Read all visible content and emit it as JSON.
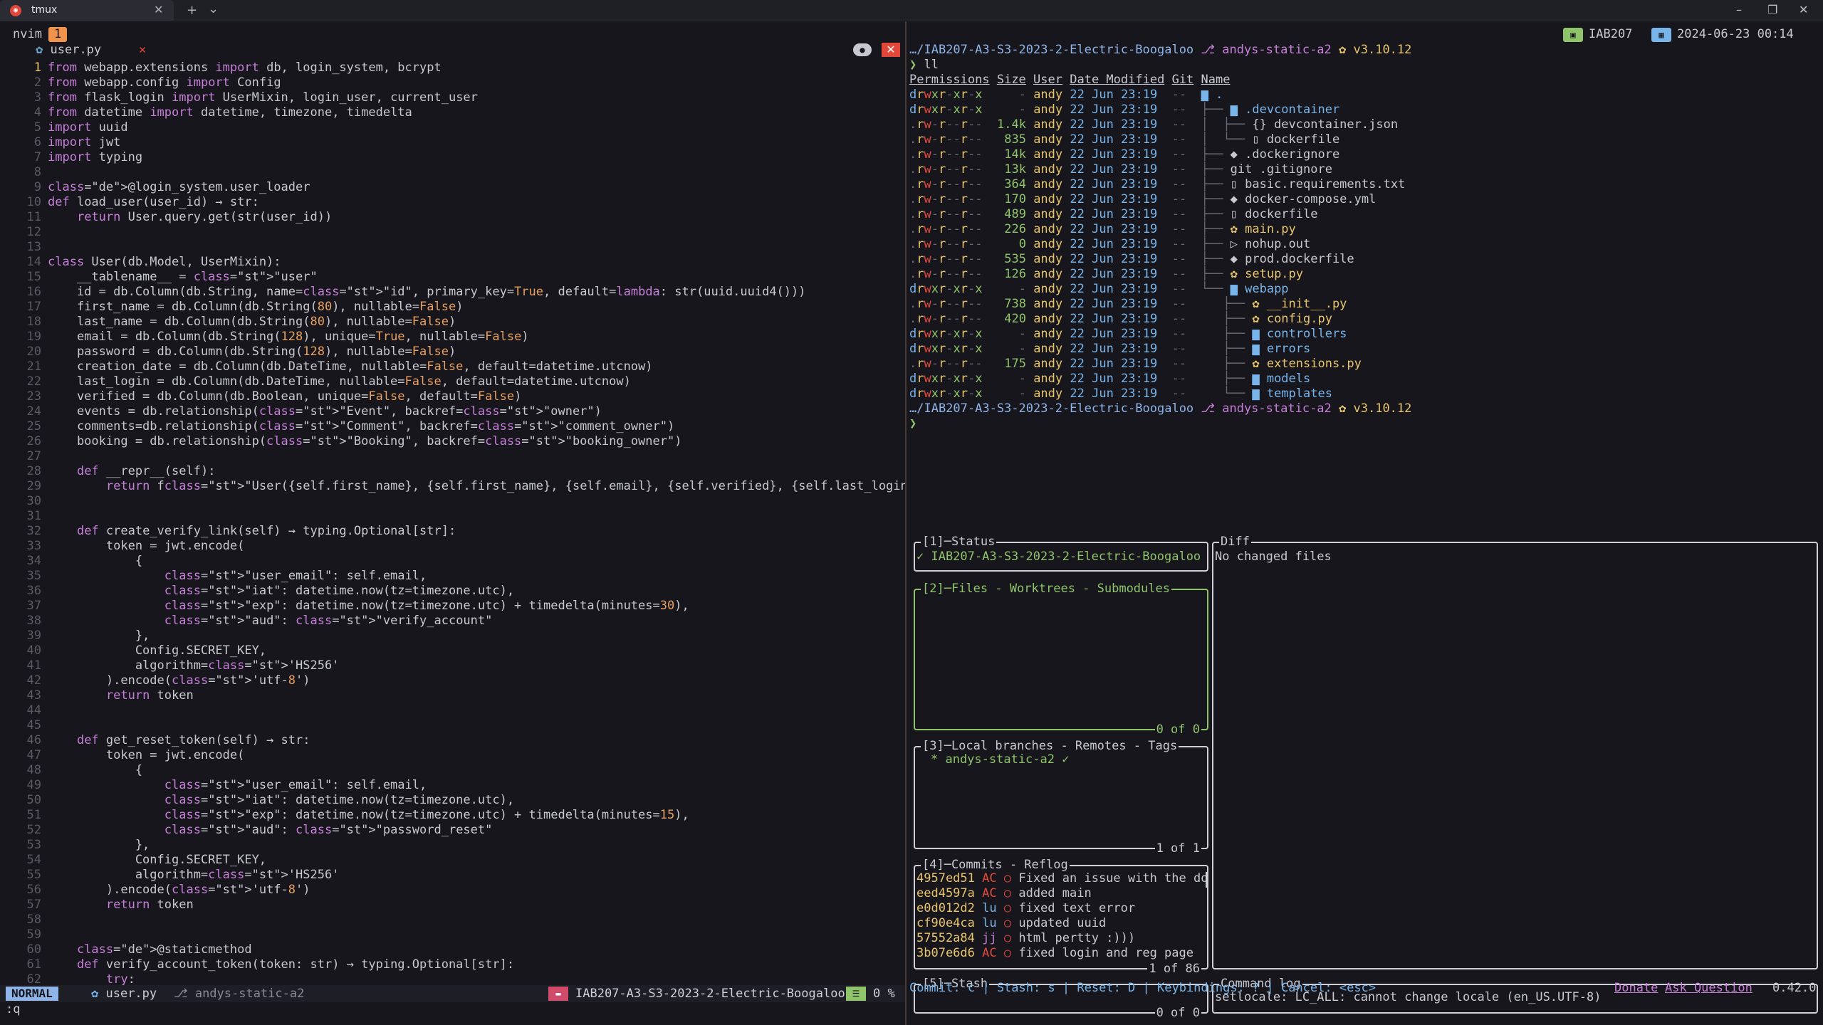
{
  "window": {
    "tab_title": "tmux",
    "new_tab_glyph": "+",
    "dropdown_glyph": "⌄",
    "close_glyph": "✕",
    "minimize_glyph": "–",
    "restore_glyph": "❐",
    "window_close_glyph": "✕"
  },
  "nvim": {
    "label": "nvim",
    "window_index": "1",
    "buffer_name": "user.py",
    "buffer_close": "✕",
    "code_lines": [
      "from webapp.extensions import db, login_system, bcrypt",
      "from webapp.config import Config",
      "from flask_login import UserMixin, login_user, current_user",
      "from datetime import datetime, timezone, timedelta",
      "import uuid",
      "import jwt",
      "import typing",
      "",
      "@login_system.user_loader",
      "def load_user(user_id) → str:",
      "    return User.query.get(str(user_id))",
      "",
      "",
      "class User(db.Model, UserMixin):",
      "    __tablename__ = \"user\"",
      "    id = db.Column(db.String, name=\"id\", primary_key=True, default=lambda: str(uuid.uuid4()))",
      "    first_name = db.Column(db.String(80), nullable=False)",
      "    last_name = db.Column(db.String(80), nullable=False)",
      "    email = db.Column(db.String(128), unique=True, nullable=False)",
      "    password = db.Column(db.String(128), nullable=False)",
      "    creation_date = db.Column(db.DateTime, nullable=False, default=datetime.utcnow)",
      "    last_login = db.Column(db.DateTime, nullable=False, default=datetime.utcnow)",
      "    verified = db.Column(db.Boolean, unique=False, default=False)",
      "    events = db.relationship(\"Event\", backref=\"owner\")",
      "    comments=db.relationship(\"Comment\", backref=\"comment_owner\")",
      "    booking = db.relationship(\"Booking\", backref=\"booking_owner\")",
      "",
      "    def __repr__(self):",
      "        return f\"User({self.first_name}, {self.first_name}, {self.email}, {self.verified}, {self.last_login})\"",
      "",
      "",
      "    def create_verify_link(self) → typing.Optional[str]:",
      "        token = jwt.encode(",
      "            {",
      "                \"user_email\": self.email,",
      "                \"iat\": datetime.now(tz=timezone.utc),",
      "                \"exp\": datetime.now(tz=timezone.utc) + timedelta(minutes=30),",
      "                \"aud\": \"verify_account\"",
      "            },",
      "            Config.SECRET_KEY,",
      "            algorithm='HS256'",
      "        ).encode('utf-8')",
      "        return token",
      "",
      "",
      "    def get_reset_token(self) → str:",
      "        token = jwt.encode(",
      "            {",
      "                \"user_email\": self.email,",
      "                \"iat\": datetime.now(tz=timezone.utc),",
      "                \"exp\": datetime.now(tz=timezone.utc) + timedelta(minutes=15),",
      "                \"aud\": \"password_reset\"",
      "            },",
      "            Config.SECRET_KEY,",
      "            algorithm='HS256'",
      "        ).encode('utf-8')",
      "        return token",
      "",
      "",
      "    @staticmethod",
      "    def verify_account_token(token: str) → typing.Optional[str]:",
      "        try:"
    ],
    "status": {
      "mode": "NORMAL",
      "file": "user.py",
      "branch": "andys-static-a2",
      "project": "IAB207-A3-S3-2023-2-Electric-Boogaloo",
      "percent": "0 %"
    },
    "cmdline": ":q"
  },
  "shell": {
    "host_badge": "IAB207",
    "date_badge": "2024-06-23 00:14",
    "prompt_path": "…/IAB207-A3-S3-2023-2-Electric-Boogaloo",
    "prompt_branch": "andys-static-a2",
    "prompt_python": "v3.10.12",
    "command": "ll",
    "headers": [
      "Permissions",
      "Size",
      "User",
      "Date Modified",
      "Git",
      "Name"
    ],
    "rows": [
      {
        "perm": "drwxr-xr-x",
        "size": "-",
        "user": "andy",
        "date": "22 Jun 23:19",
        "git": "--",
        "tree": "",
        "name": ".",
        "kind": "dir"
      },
      {
        "perm": "drwxr-xr-x",
        "size": "-",
        "user": "andy",
        "date": "22 Jun 23:19",
        "git": "--",
        "tree": "├── ",
        "name": ".devcontainer",
        "kind": "dir"
      },
      {
        "perm": ".rw-r--r--",
        "size": "1.4k",
        "user": "andy",
        "date": "22 Jun 23:19",
        "git": "--",
        "tree": "│  ├── ",
        "name": "devcontainer.json",
        "kind": "json"
      },
      {
        "perm": ".rw-r--r--",
        "size": "835",
        "user": "andy",
        "date": "22 Jun 23:19",
        "git": "--",
        "tree": "│  └── ",
        "name": "dockerfile",
        "kind": "file"
      },
      {
        "perm": ".rw-r--r--",
        "size": "14k",
        "user": "andy",
        "date": "22 Jun 23:19",
        "git": "--",
        "tree": "├── ",
        "name": ".dockerignore",
        "kind": "docker"
      },
      {
        "perm": ".rw-r--r--",
        "size": "13k",
        "user": "andy",
        "date": "22 Jun 23:19",
        "git": "--",
        "tree": "├── ",
        "name": ".gitignore",
        "kind": "git"
      },
      {
        "perm": ".rw-r--r--",
        "size": "364",
        "user": "andy",
        "date": "22 Jun 23:19",
        "git": "--",
        "tree": "├── ",
        "name": "basic.requirements.txt",
        "kind": "file"
      },
      {
        "perm": ".rw-r--r--",
        "size": "170",
        "user": "andy",
        "date": "22 Jun 23:19",
        "git": "--",
        "tree": "├── ",
        "name": "docker-compose.yml",
        "kind": "docker"
      },
      {
        "perm": ".rw-r--r--",
        "size": "489",
        "user": "andy",
        "date": "22 Jun 23:19",
        "git": "--",
        "tree": "├── ",
        "name": "dockerfile",
        "kind": "file"
      },
      {
        "perm": ".rw-r--r--",
        "size": "226",
        "user": "andy",
        "date": "22 Jun 23:19",
        "git": "--",
        "tree": "├── ",
        "name": "main.py",
        "kind": "py"
      },
      {
        "perm": ".rw-r--r--",
        "size": "0",
        "user": "andy",
        "date": "22 Jun 23:19",
        "git": "--",
        "tree": "├── ",
        "name": "nohup.out",
        "kind": "out"
      },
      {
        "perm": ".rw-r--r--",
        "size": "535",
        "user": "andy",
        "date": "22 Jun 23:19",
        "git": "--",
        "tree": "├── ",
        "name": "prod.dockerfile",
        "kind": "docker"
      },
      {
        "perm": ".rw-r--r--",
        "size": "126",
        "user": "andy",
        "date": "22 Jun 23:19",
        "git": "--",
        "tree": "├── ",
        "name": "setup.py",
        "kind": "py"
      },
      {
        "perm": "drwxr-xr-x",
        "size": "-",
        "user": "andy",
        "date": "22 Jun 23:19",
        "git": "--",
        "tree": "└── ",
        "name": "webapp",
        "kind": "dir"
      },
      {
        "perm": ".rw-r--r--",
        "size": "738",
        "user": "andy",
        "date": "22 Jun 23:19",
        "git": "--",
        "tree": "   ├── ",
        "name": "__init__.py",
        "kind": "py"
      },
      {
        "perm": ".rw-r--r--",
        "size": "420",
        "user": "andy",
        "date": "22 Jun 23:19",
        "git": "--",
        "tree": "   ├── ",
        "name": "config.py",
        "kind": "py"
      },
      {
        "perm": "drwxr-xr-x",
        "size": "-",
        "user": "andy",
        "date": "22 Jun 23:19",
        "git": "--",
        "tree": "   ├── ",
        "name": "controllers",
        "kind": "dir"
      },
      {
        "perm": "drwxr-xr-x",
        "size": "-",
        "user": "andy",
        "date": "22 Jun 23:19",
        "git": "--",
        "tree": "   ├── ",
        "name": "errors",
        "kind": "dir"
      },
      {
        "perm": ".rw-r--r--",
        "size": "175",
        "user": "andy",
        "date": "22 Jun 23:19",
        "git": "--",
        "tree": "   ├── ",
        "name": "extensions.py",
        "kind": "py"
      },
      {
        "perm": "drwxr-xr-x",
        "size": "-",
        "user": "andy",
        "date": "22 Jun 23:19",
        "git": "--",
        "tree": "   ├── ",
        "name": "models",
        "kind": "dir"
      },
      {
        "perm": "drwxr-xr-x",
        "size": "-",
        "user": "andy",
        "date": "22 Jun 23:19",
        "git": "--",
        "tree": "   └── ",
        "name": "templates",
        "kind": "dir"
      }
    ],
    "cursor_glyph": "❯"
  },
  "lazygit": {
    "status_title": "[1]─Status",
    "status_value": "✓ IAB207-A3-S3-2023-2-Electric-Boogaloo",
    "files_title": "[2]─Files - Worktrees - Submodules",
    "files_footer": "0 of 0",
    "branches_title": "[3]─Local branches - Remotes - Tags",
    "branch_item": "* andys-static-a2 ✓",
    "branches_footer": "1 of 1",
    "commits_title": "[4]─Commits - Reflog",
    "commits": [
      {
        "hash": "4957ed51",
        "author": "AC",
        "msg": "Fixed an issue with the do"
      },
      {
        "hash": "eed4597a",
        "author": "AC",
        "msg": "added main"
      },
      {
        "hash": "e0d012d2",
        "author": "lu",
        "msg": "fixed text error"
      },
      {
        "hash": "cf90e4ca",
        "author": "lu",
        "msg": "updated uuid"
      },
      {
        "hash": "57552a84",
        "author": "jj",
        "msg": "html pertty :)))"
      },
      {
        "hash": "3b07e6d6",
        "author": "AC",
        "msg": "fixed login and reg page"
      }
    ],
    "commits_footer": "1 of 86",
    "stash_title": "[5]─Stash",
    "stash_footer": "0 of 0",
    "diff_title": "Diff",
    "diff_value": "No changed files",
    "cmdlog_title": "Command log",
    "cmdlog_value": "setlocale: LC_ALL: cannot change locale (en_US.UTF-8)",
    "keybindings": "Commit: c | Stash: s | Reset: D | Keybindings: ? | Cancel: <esc>",
    "donate": "Donate",
    "ask": "Ask Question",
    "version": "0.42.0"
  }
}
